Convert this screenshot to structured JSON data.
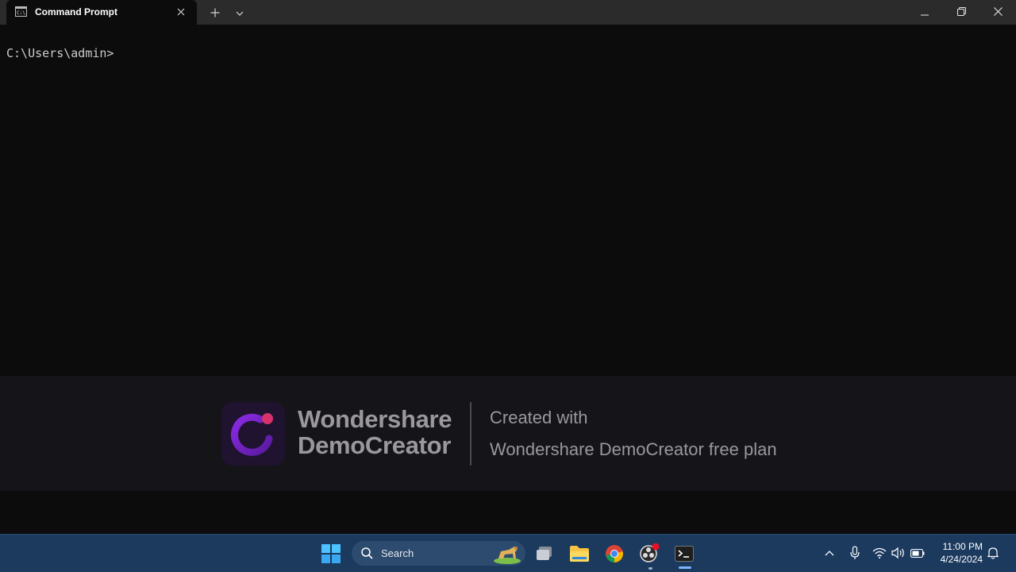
{
  "window": {
    "tab_title": "Command Prompt",
    "new_tab_label": "+",
    "dropdown_icon": "chevron-down-icon",
    "close_tab_icon": "close-icon"
  },
  "console": {
    "prompt": "C:\\Users\\admin>"
  },
  "watermark": {
    "brand_line1": "Wondershare",
    "brand_line2": "DemoCreator",
    "created_with": "Created with",
    "plan_text": "Wondershare DemoCreator free plan"
  },
  "taskbar": {
    "search_placeholder": "Search",
    "pinned": [
      "windows-start-icon",
      "task-view-icon",
      "file-explorer-icon",
      "chrome-icon",
      "obs-icon",
      "terminal-icon"
    ],
    "tray": [
      "show-hidden-icons-icon",
      "microphone-icon",
      "wifi-icon",
      "volume-icon",
      "battery-icon",
      "notification-bell-icon"
    ],
    "time": "11:00 PM",
    "date": "4/24/2024",
    "accent_color": "#1b3a5e"
  }
}
